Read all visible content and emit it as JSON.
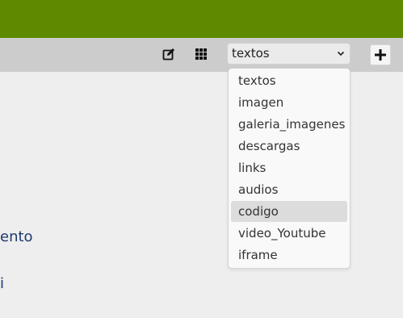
{
  "toolbar": {
    "edit_icon": "edit-icon",
    "grid_icon": "grid-icon",
    "add_icon": "plus-icon"
  },
  "type_select": {
    "value": "textos",
    "options": [
      "textos",
      "imagen",
      "galeria_imagenes",
      "descargas",
      "links",
      "audios",
      "codigo",
      "video_Youtube",
      "iframe"
    ],
    "highlighted": "codigo"
  },
  "background": {
    "link_1": "ento",
    "link_2": "i"
  },
  "colors": {
    "header": "#5f8a00",
    "toolbar": "#cccccc",
    "link": "#1f3a6e"
  }
}
